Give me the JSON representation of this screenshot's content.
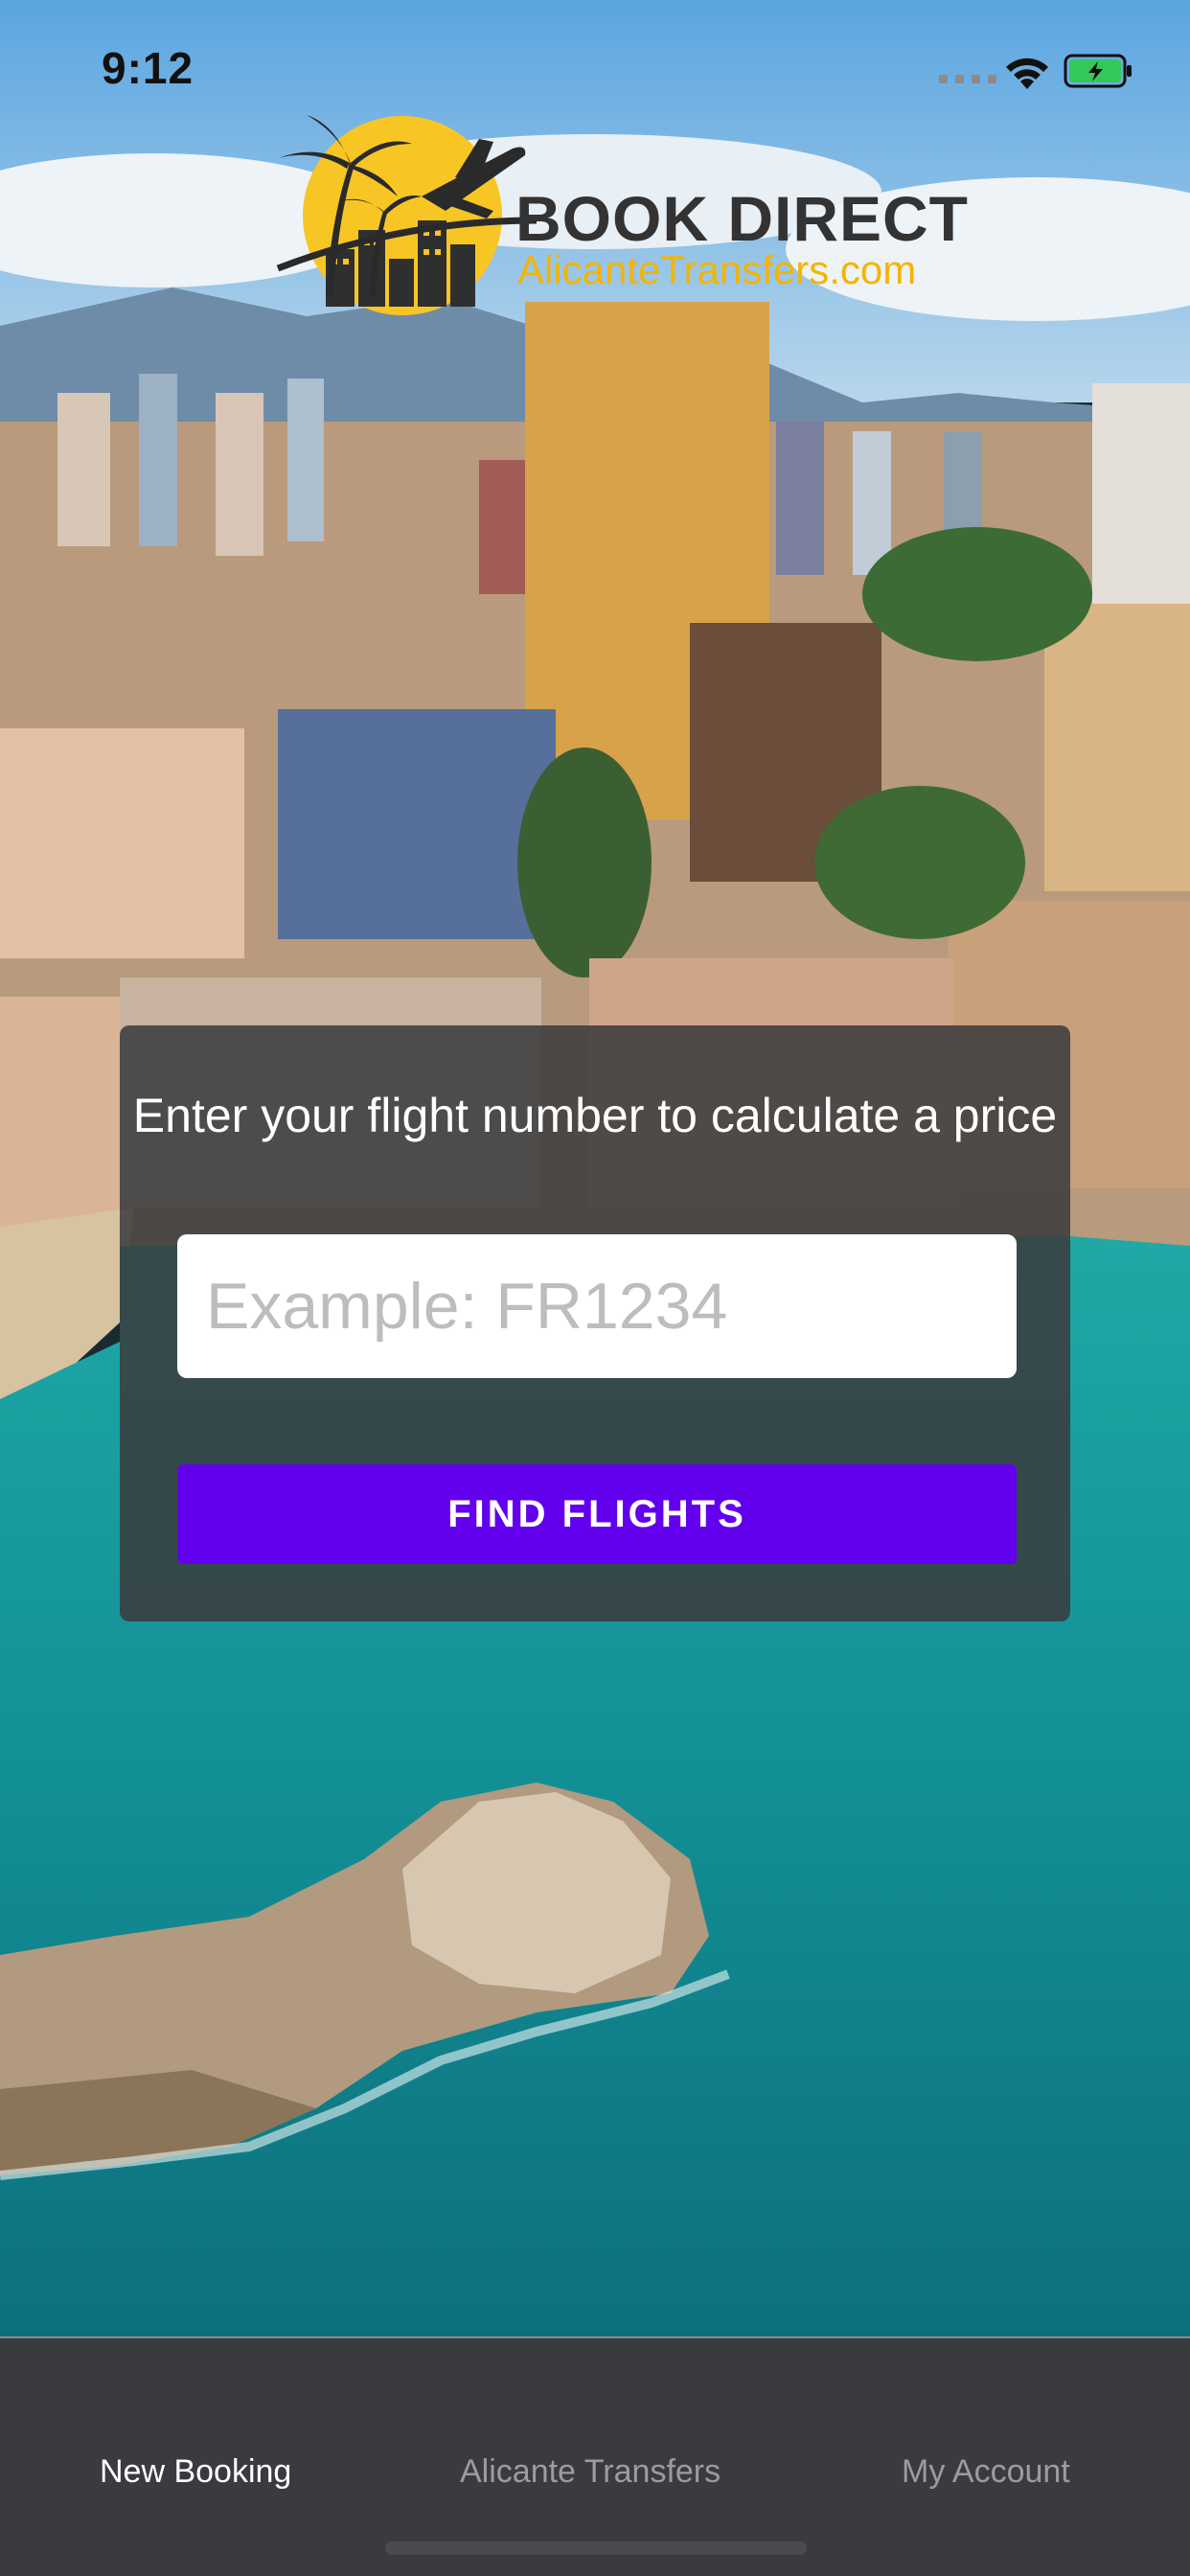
{
  "status_bar": {
    "time": "9:12"
  },
  "brand": {
    "title": "BOOK DIRECT",
    "subtitle": "AlicanteTransfers.com"
  },
  "flight_search": {
    "prompt": "Enter your flight number to calculate a price",
    "input_placeholder": "Example: FR1234",
    "input_value": "",
    "button_label": "FIND FLIGHTS",
    "button_color": "#6200ee"
  },
  "tab_bar": {
    "tabs": [
      {
        "label": "New Booking",
        "active": true
      },
      {
        "label": "Alicante Transfers",
        "active": false
      },
      {
        "label": "My Account",
        "active": false
      }
    ]
  },
  "icons": [
    "wifi-icon",
    "battery-charging-icon",
    "signal-icon",
    "palm-tree-icon",
    "airplane-icon",
    "sun-icon"
  ]
}
